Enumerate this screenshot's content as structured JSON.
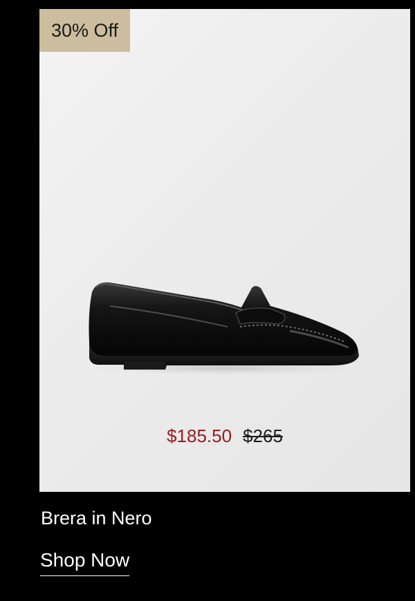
{
  "product": {
    "badge": "30% Off",
    "image_icon": "penny-loafer-shoe",
    "sale_price": "$185.50",
    "original_price": "$265",
    "name": "Brera in Nero",
    "cta_label": "Shop Now"
  },
  "colors": {
    "page_background": "#000000",
    "card_background": "#ececec",
    "badge_background": "#cbbd9d",
    "sale_price": "#9b1b1b",
    "text_light": "#ffffff",
    "text_dark": "#1b1b1b"
  }
}
